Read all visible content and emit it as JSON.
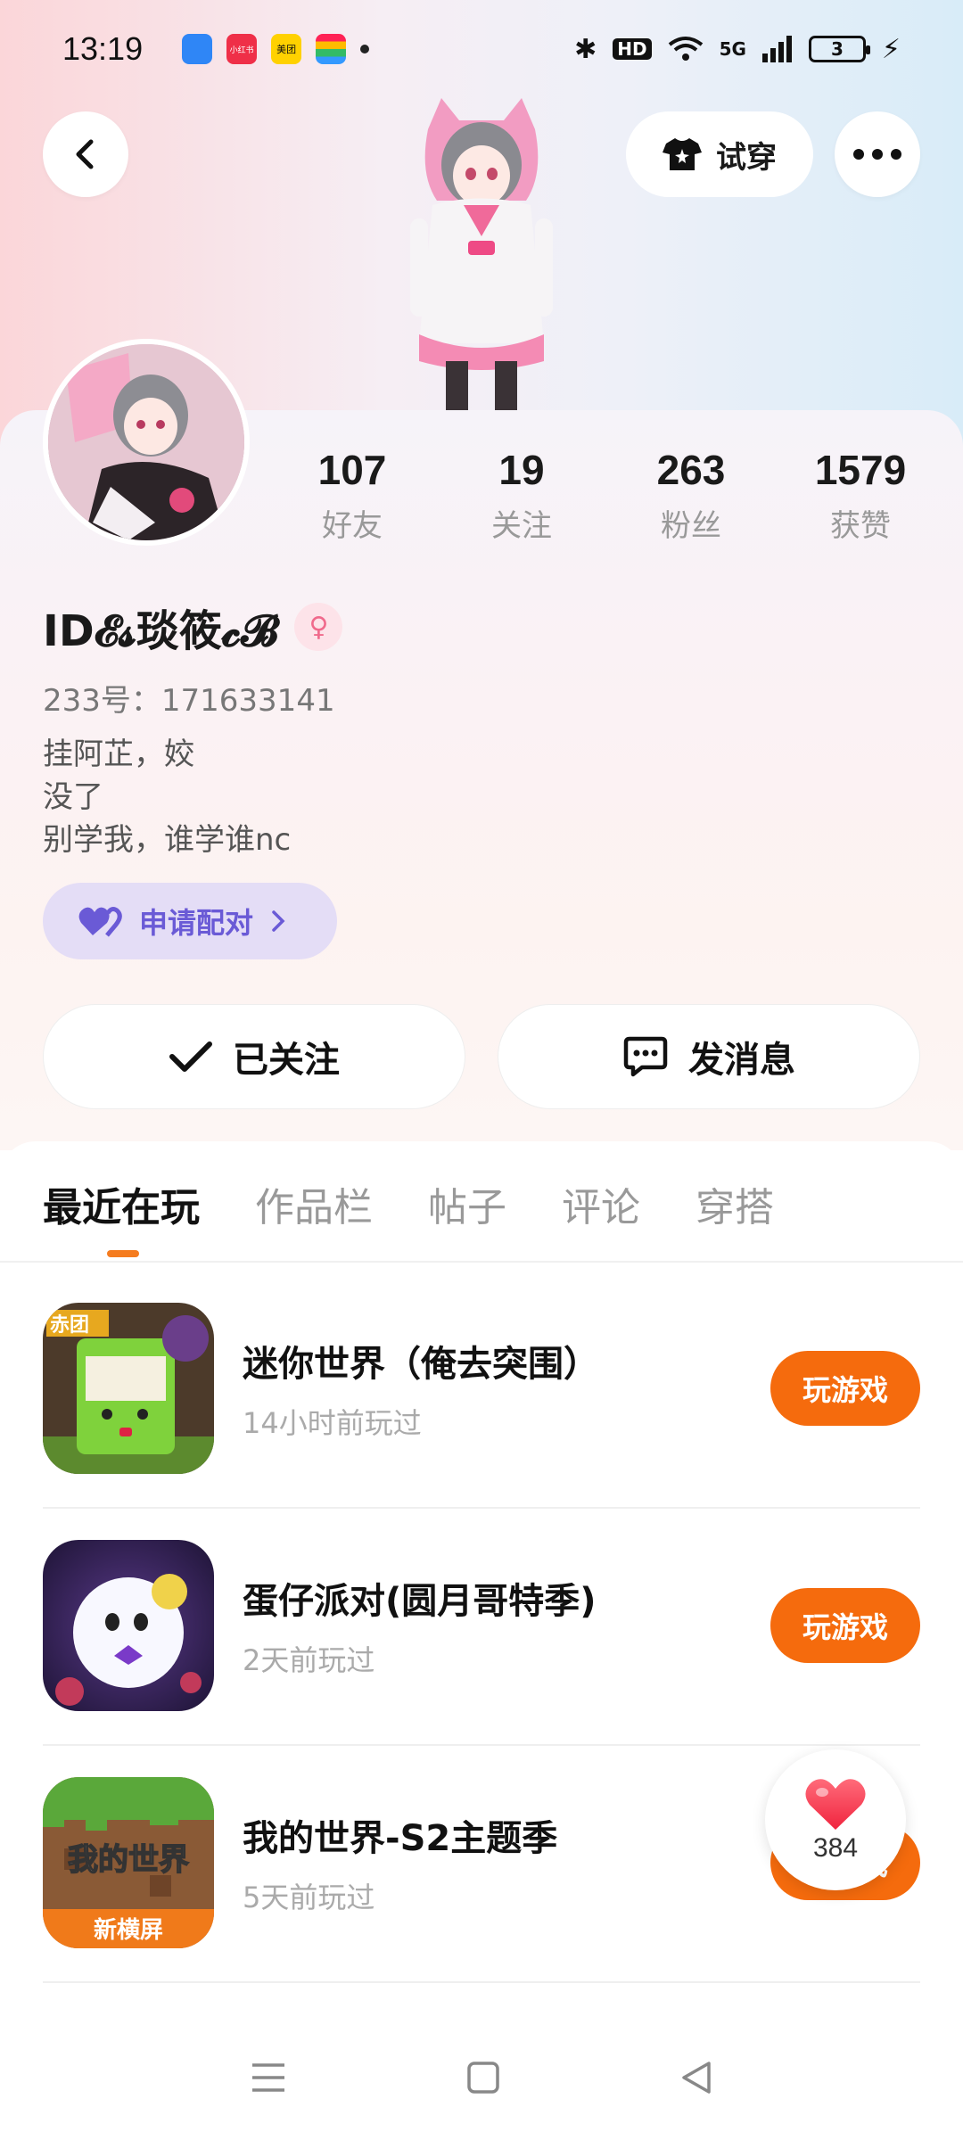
{
  "status_bar": {
    "time": "13:19",
    "app_icons": [
      {
        "name": "app-blue",
        "color": "#2f86f6",
        "label": ""
      },
      {
        "name": "xiaohongshu",
        "color": "#ef2f48",
        "label": "小红书"
      },
      {
        "name": "meituan",
        "color": "#ffd100",
        "label": "美团"
      },
      {
        "name": "app-stripes",
        "color": "#e8eaf0",
        "label": ""
      }
    ],
    "network": "5G",
    "hd": "HD",
    "battery": "3"
  },
  "header": {
    "back_icon": "chevron-left-icon",
    "try_on_label": "试穿",
    "more_icon": "more-dots-icon"
  },
  "profile": {
    "stats": [
      {
        "value": "107",
        "label": "好友"
      },
      {
        "value": "19",
        "label": "关注"
      },
      {
        "value": "263",
        "label": "粉丝"
      },
      {
        "value": "1579",
        "label": "获赞"
      }
    ],
    "username": "ID𝓔𝓼琰筱𝓬𝓑",
    "gender_icon": "female-icon",
    "uid": "233号：171633141",
    "bio": [
      "挂阿芷，姣",
      "没了",
      "别学我，谁学谁nc"
    ],
    "pair_label": "申请配对",
    "follow_label": "已关注",
    "message_label": "发消息"
  },
  "tabs": [
    {
      "label": "最近在玩",
      "active": true
    },
    {
      "label": "作品栏",
      "active": false
    },
    {
      "label": "帖子",
      "active": false
    },
    {
      "label": "评论",
      "active": false
    },
    {
      "label": "穿搭",
      "active": false
    }
  ],
  "games": [
    {
      "title": "迷你世界（俺去突围）",
      "subtitle": "14小时前玩过",
      "button": "玩游戏",
      "icon": "mini-world-icon"
    },
    {
      "title": "蛋仔派对(圆月哥特季)",
      "subtitle": "2天前玩过",
      "button": "玩游戏",
      "icon": "eggy-party-icon"
    },
    {
      "title": "我的世界-S2主题季",
      "subtitle": "5天前玩过",
      "button": "玩游戏",
      "icon": "minecraft-icon"
    }
  ],
  "minecraft_icon_text": {
    "top": "我的世界",
    "bottom": "新横屏"
  },
  "mini_world_badge": "赤团",
  "like_float": {
    "count": "384"
  },
  "colors": {
    "accent": "#f56b0d",
    "pair": "#6a5ad6"
  }
}
